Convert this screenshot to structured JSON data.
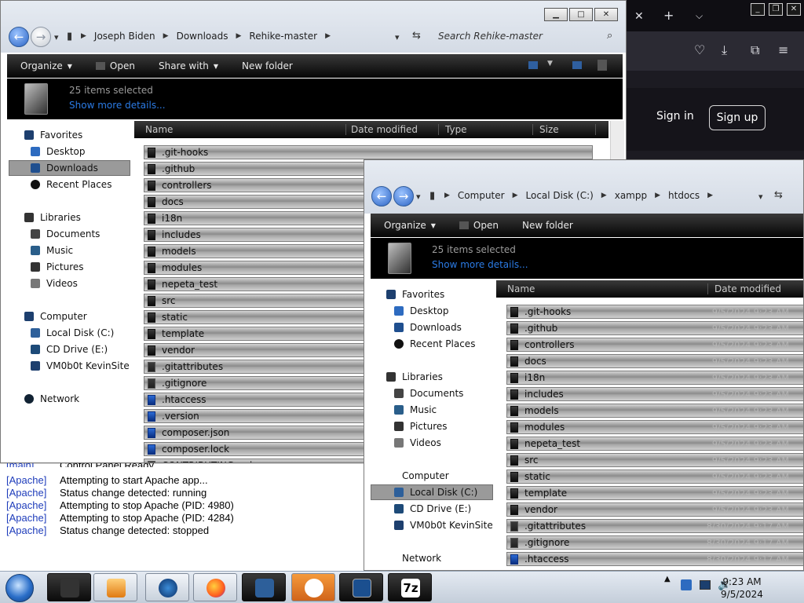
{
  "browser": {
    "signin_label": "Sign in",
    "signup_label": "Sign up",
    "icons": [
      "close-icon",
      "new-tab-icon",
      "chevron-down-icon",
      "pocket-icon",
      "download-icon",
      "extensions-icon",
      "menu-icon"
    ]
  },
  "log": {
    "truncated_tag": "[main]",
    "truncated_text": "Control Panel Ready",
    "rows": [
      {
        "tag": "[Apache]",
        "text": "Attempting to start Apache app..."
      },
      {
        "tag": "[Apache]",
        "text": "Status change detected: running"
      },
      {
        "tag": "[Apache]",
        "text": "Attempting to stop Apache (PID: 4980)"
      },
      {
        "tag": "[Apache]",
        "text": "Attempting to stop Apache (PID: 4284)"
      },
      {
        "tag": "[Apache]",
        "text": "Status change detected: stopped"
      }
    ]
  },
  "explorer1": {
    "breadcrumb": [
      "Joseph Biden",
      "Downloads",
      "Rehike-master"
    ],
    "search_placeholder": "Search Rehike-master",
    "toolbar": {
      "organize": "Organize",
      "open": "Open",
      "share_with": "Share with",
      "new_folder": "New folder"
    },
    "details": {
      "count": "25 items selected",
      "more": "Show more details..."
    },
    "columns": [
      "Name",
      "Date modified",
      "Type",
      "Size"
    ],
    "nav": {
      "favorites": "Favorites",
      "desktop": "Desktop",
      "downloads": "Downloads",
      "recent": "Recent Places",
      "libraries": "Libraries",
      "documents": "Documents",
      "music": "Music",
      "pictures": "Pictures",
      "videos": "Videos",
      "computer": "Computer",
      "local_disk": "Local Disk (C:)",
      "cd_drive": "CD Drive (E:)",
      "vm_site": "VM0b0t KevinSite",
      "network": "Network"
    },
    "files": [
      ".git-hooks",
      ".github",
      "controllers",
      "docs",
      "i18n",
      "includes",
      "models",
      "modules",
      "nepeta_test",
      "src",
      "static",
      "template",
      "vendor",
      ".gitattributes",
      ".gitignore",
      ".htaccess",
      ".version",
      "composer.json",
      "composer.lock",
      "CONTRIBUTING.md"
    ]
  },
  "explorer2": {
    "breadcrumb": [
      "Computer",
      "Local Disk (C:)",
      "xampp",
      "htdocs"
    ],
    "toolbar": {
      "organize": "Organize",
      "open": "Open",
      "new_folder": "New folder"
    },
    "details": {
      "count": "25 items selected",
      "more": "Show more details..."
    },
    "columns": [
      "Name",
      "Date modified"
    ],
    "nav": {
      "favorites": "Favorites",
      "desktop": "Desktop",
      "downloads": "Downloads",
      "recent": "Recent Places",
      "libraries": "Libraries",
      "documents": "Documents",
      "music": "Music",
      "pictures": "Pictures",
      "videos": "Videos",
      "computer": "Computer",
      "local_disk": "Local Disk (C:)",
      "cd_drive": "CD Drive (E:)",
      "vm_site": "VM0b0t KevinSite",
      "network": "Network"
    },
    "files": [
      {
        "name": ".git-hooks",
        "date": "9/5/2024 9:23 AM"
      },
      {
        "name": ".github",
        "date": "9/5/2024 9:23 AM"
      },
      {
        "name": "controllers",
        "date": "9/5/2024 9:23 AM"
      },
      {
        "name": "docs",
        "date": "9/5/2024 9:23 AM"
      },
      {
        "name": "i18n",
        "date": "9/5/2024 9:23 AM"
      },
      {
        "name": "includes",
        "date": "9/5/2024 9:23 AM"
      },
      {
        "name": "models",
        "date": "9/5/2024 9:23 AM"
      },
      {
        "name": "modules",
        "date": "9/5/2024 9:23 AM"
      },
      {
        "name": "nepeta_test",
        "date": "9/5/2024 9:23 AM"
      },
      {
        "name": "src",
        "date": "9/5/2024 9:23 AM"
      },
      {
        "name": "static",
        "date": "9/5/2024 9:23 AM"
      },
      {
        "name": "template",
        "date": "9/5/2024 9:23 AM"
      },
      {
        "name": "vendor",
        "date": "9/5/2024 9:23 AM"
      },
      {
        "name": ".gitattributes",
        "date": "8/30/2024 9:17 AM"
      },
      {
        "name": ".gitignore",
        "date": "8/30/2024 9:17 AM"
      },
      {
        "name": ".htaccess",
        "date": "8/30/2024 9:17 AM"
      }
    ]
  },
  "taskbar": {
    "time": "9:23 AM",
    "date": "9/5/2024",
    "apps": [
      "explorer-app",
      "media-player-app",
      "browser-app",
      "firefox-app",
      "control-panel-app",
      "xampp-app",
      "terminal-app",
      "7zip-app"
    ],
    "sevenzip_label": "7z"
  },
  "colors": {
    "accent": "#2b6fc9",
    "link": "#2b7be5",
    "log_tag": "#1f3dbb"
  }
}
